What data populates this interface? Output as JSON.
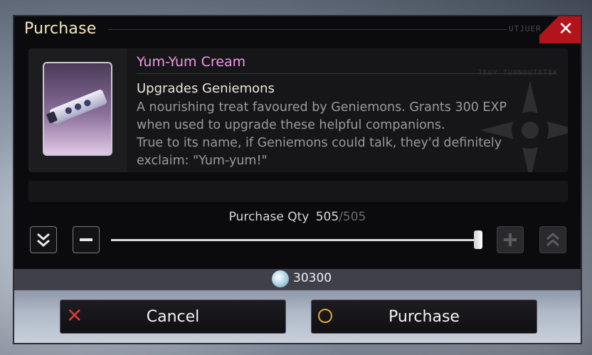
{
  "dialog": {
    "title": "Purchase",
    "title_code": "UTJUER",
    "close_icon": "close-icon"
  },
  "item": {
    "name": "Yum-Yum Cream",
    "code": "TEUY TUNNOUTETEK",
    "subtitle": "Upgrades Geniemons",
    "description": [
      "A nourishing treat favoured by Geniemons. Grants 300 EXP",
      "when used to upgrade these helpful companions.",
      "True to its name, if Geniemons could talk, they'd definitely",
      "exclaim: \"Yum-yum!\""
    ],
    "image_icon": "cream-tube-icon"
  },
  "quantity": {
    "label": "Purchase Qty",
    "current": "505",
    "separator": "/",
    "max": "505",
    "fill_fraction": 1.0,
    "decrease_max_icon": "double-chevron-down-icon",
    "decrease_icon": "minus-icon",
    "increase_icon": "plus-icon",
    "increase_max_icon": "double-chevron-up-icon"
  },
  "cost": {
    "amount": "30300",
    "currency_icon": "gil-coin-icon"
  },
  "buttons": {
    "cancel_label": "Cancel",
    "purchase_label": "Purchase",
    "cancel_icon": "cross-icon",
    "purchase_icon": "circle-icon"
  },
  "colors": {
    "title": "#f3e7b8",
    "item_name": "#ec9ae6",
    "close_red": "#b3131b",
    "cancel_x": "#d33b35",
    "purchase_o": "#e0a83a"
  }
}
